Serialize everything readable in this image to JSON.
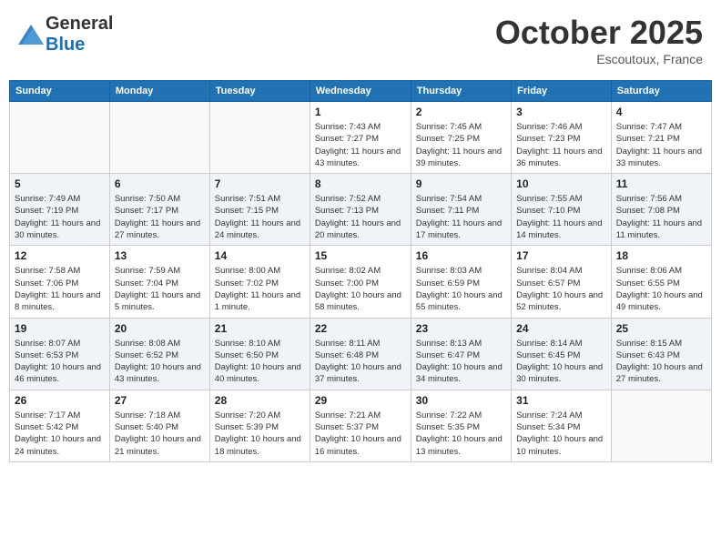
{
  "header": {
    "logo_general": "General",
    "logo_blue": "Blue",
    "month": "October 2025",
    "location": "Escoutoux, France"
  },
  "days_of_week": [
    "Sunday",
    "Monday",
    "Tuesday",
    "Wednesday",
    "Thursday",
    "Friday",
    "Saturday"
  ],
  "weeks": [
    [
      {
        "day": "",
        "info": ""
      },
      {
        "day": "",
        "info": ""
      },
      {
        "day": "",
        "info": ""
      },
      {
        "day": "1",
        "info": "Sunrise: 7:43 AM\nSunset: 7:27 PM\nDaylight: 11 hours and 43 minutes."
      },
      {
        "day": "2",
        "info": "Sunrise: 7:45 AM\nSunset: 7:25 PM\nDaylight: 11 hours and 39 minutes."
      },
      {
        "day": "3",
        "info": "Sunrise: 7:46 AM\nSunset: 7:23 PM\nDaylight: 11 hours and 36 minutes."
      },
      {
        "day": "4",
        "info": "Sunrise: 7:47 AM\nSunset: 7:21 PM\nDaylight: 11 hours and 33 minutes."
      }
    ],
    [
      {
        "day": "5",
        "info": "Sunrise: 7:49 AM\nSunset: 7:19 PM\nDaylight: 11 hours and 30 minutes."
      },
      {
        "day": "6",
        "info": "Sunrise: 7:50 AM\nSunset: 7:17 PM\nDaylight: 11 hours and 27 minutes."
      },
      {
        "day": "7",
        "info": "Sunrise: 7:51 AM\nSunset: 7:15 PM\nDaylight: 11 hours and 24 minutes."
      },
      {
        "day": "8",
        "info": "Sunrise: 7:52 AM\nSunset: 7:13 PM\nDaylight: 11 hours and 20 minutes."
      },
      {
        "day": "9",
        "info": "Sunrise: 7:54 AM\nSunset: 7:11 PM\nDaylight: 11 hours and 17 minutes."
      },
      {
        "day": "10",
        "info": "Sunrise: 7:55 AM\nSunset: 7:10 PM\nDaylight: 11 hours and 14 minutes."
      },
      {
        "day": "11",
        "info": "Sunrise: 7:56 AM\nSunset: 7:08 PM\nDaylight: 11 hours and 11 minutes."
      }
    ],
    [
      {
        "day": "12",
        "info": "Sunrise: 7:58 AM\nSunset: 7:06 PM\nDaylight: 11 hours and 8 minutes."
      },
      {
        "day": "13",
        "info": "Sunrise: 7:59 AM\nSunset: 7:04 PM\nDaylight: 11 hours and 5 minutes."
      },
      {
        "day": "14",
        "info": "Sunrise: 8:00 AM\nSunset: 7:02 PM\nDaylight: 11 hours and 1 minute."
      },
      {
        "day": "15",
        "info": "Sunrise: 8:02 AM\nSunset: 7:00 PM\nDaylight: 10 hours and 58 minutes."
      },
      {
        "day": "16",
        "info": "Sunrise: 8:03 AM\nSunset: 6:59 PM\nDaylight: 10 hours and 55 minutes."
      },
      {
        "day": "17",
        "info": "Sunrise: 8:04 AM\nSunset: 6:57 PM\nDaylight: 10 hours and 52 minutes."
      },
      {
        "day": "18",
        "info": "Sunrise: 8:06 AM\nSunset: 6:55 PM\nDaylight: 10 hours and 49 minutes."
      }
    ],
    [
      {
        "day": "19",
        "info": "Sunrise: 8:07 AM\nSunset: 6:53 PM\nDaylight: 10 hours and 46 minutes."
      },
      {
        "day": "20",
        "info": "Sunrise: 8:08 AM\nSunset: 6:52 PM\nDaylight: 10 hours and 43 minutes."
      },
      {
        "day": "21",
        "info": "Sunrise: 8:10 AM\nSunset: 6:50 PM\nDaylight: 10 hours and 40 minutes."
      },
      {
        "day": "22",
        "info": "Sunrise: 8:11 AM\nSunset: 6:48 PM\nDaylight: 10 hours and 37 minutes."
      },
      {
        "day": "23",
        "info": "Sunrise: 8:13 AM\nSunset: 6:47 PM\nDaylight: 10 hours and 34 minutes."
      },
      {
        "day": "24",
        "info": "Sunrise: 8:14 AM\nSunset: 6:45 PM\nDaylight: 10 hours and 30 minutes."
      },
      {
        "day": "25",
        "info": "Sunrise: 8:15 AM\nSunset: 6:43 PM\nDaylight: 10 hours and 27 minutes."
      }
    ],
    [
      {
        "day": "26",
        "info": "Sunrise: 7:17 AM\nSunset: 5:42 PM\nDaylight: 10 hours and 24 minutes."
      },
      {
        "day": "27",
        "info": "Sunrise: 7:18 AM\nSunset: 5:40 PM\nDaylight: 10 hours and 21 minutes."
      },
      {
        "day": "28",
        "info": "Sunrise: 7:20 AM\nSunset: 5:39 PM\nDaylight: 10 hours and 18 minutes."
      },
      {
        "day": "29",
        "info": "Sunrise: 7:21 AM\nSunset: 5:37 PM\nDaylight: 10 hours and 16 minutes."
      },
      {
        "day": "30",
        "info": "Sunrise: 7:22 AM\nSunset: 5:35 PM\nDaylight: 10 hours and 13 minutes."
      },
      {
        "day": "31",
        "info": "Sunrise: 7:24 AM\nSunset: 5:34 PM\nDaylight: 10 hours and 10 minutes."
      },
      {
        "day": "",
        "info": ""
      }
    ]
  ]
}
